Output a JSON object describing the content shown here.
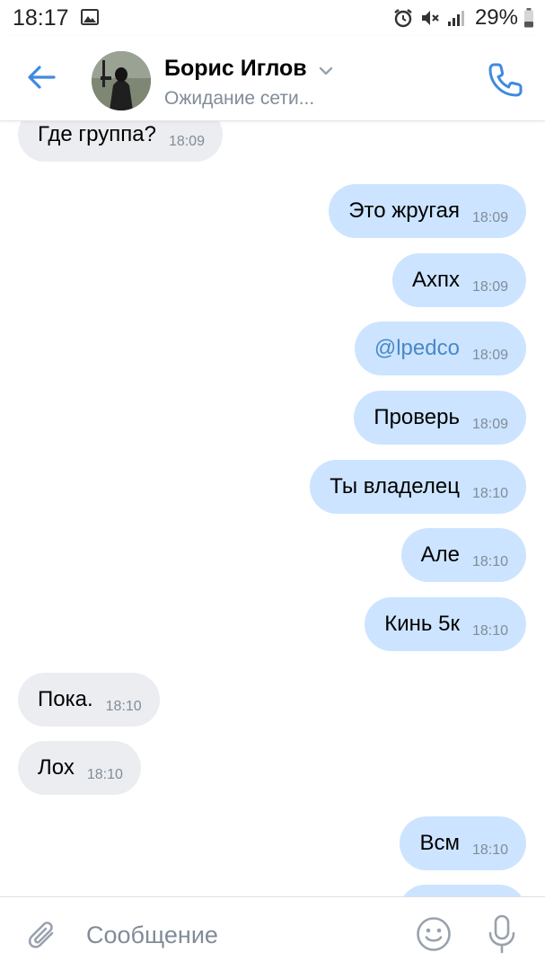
{
  "status_bar": {
    "time": "18:17",
    "battery": "29%",
    "icons": [
      "gallery-icon",
      "alarm-icon",
      "mute-icon",
      "signal-icon",
      "battery-icon"
    ]
  },
  "header": {
    "contact_name": "Борис Иглов",
    "status": "Ожидание сети...",
    "icons": [
      "back-arrow-icon",
      "chevron-down-icon",
      "phone-icon"
    ]
  },
  "messages": [
    {
      "direction": "in",
      "text": "Где группа?",
      "time": "18:09"
    },
    {
      "direction": "out",
      "text": "Это жругая",
      "time": "18:09"
    },
    {
      "direction": "out",
      "text": "Ахпх",
      "time": "18:09"
    },
    {
      "direction": "out",
      "text": "@lpedco",
      "time": "18:09",
      "mention": true
    },
    {
      "direction": "out",
      "text": "Проверь",
      "time": "18:09"
    },
    {
      "direction": "out",
      "text": "Ты владелец",
      "time": "18:10"
    },
    {
      "direction": "out",
      "text": "Але",
      "time": "18:10"
    },
    {
      "direction": "out",
      "text": "Кинь 5к",
      "time": "18:10"
    },
    {
      "direction": "in",
      "text": "Пока.",
      "time": "18:10"
    },
    {
      "direction": "in",
      "text": "Лох",
      "time": "18:10"
    },
    {
      "direction": "out",
      "text": "Всм",
      "time": "18:10"
    }
  ],
  "composer": {
    "placeholder": "Сообщение",
    "value": "",
    "icons": [
      "paperclip-icon",
      "emoji-icon",
      "microphone-icon"
    ]
  },
  "colors": {
    "accent": "#3f8ae0",
    "outgoing_bubble": "#cce4ff",
    "incoming_bubble": "#ebedf0",
    "secondary_text": "#818c99",
    "mention": "#4a88c6"
  }
}
